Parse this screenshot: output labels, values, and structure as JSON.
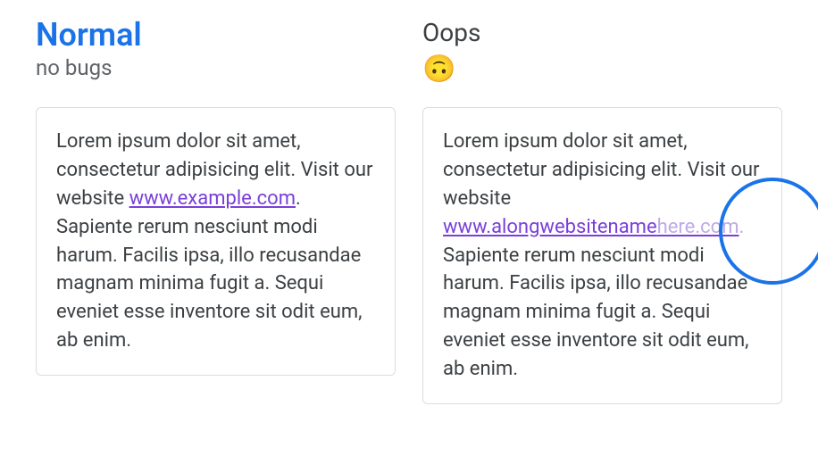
{
  "left": {
    "title": "Normal",
    "subtitle": "no bugs",
    "text_before": "Lorem ipsum dolor sit amet, consectetur adipisicing elit. Visit our website ",
    "link": "www.example.com",
    "text_after": ". Sapiente rerum nesciunt modi harum. Facilis ipsa, illo recusandae magnam minima fugit a. Sequi eveniet esse inventore sit odit eum, ab enim."
  },
  "right": {
    "title": "Oops",
    "emoji": "🙃",
    "text_before": "Lorem ipsum dolor sit amet, consectetur adipisicing elit. Visit our website ",
    "link_visible": "www.alongwebsitename",
    "link_overflow": "here.com",
    "period": ".",
    "text_after": " Sapiente rerum nesciunt modi harum. Facilis ipsa, illo recusandae magnam minima fugit a. Sequi eveniet esse inventore sit odit eum, ab enim."
  }
}
